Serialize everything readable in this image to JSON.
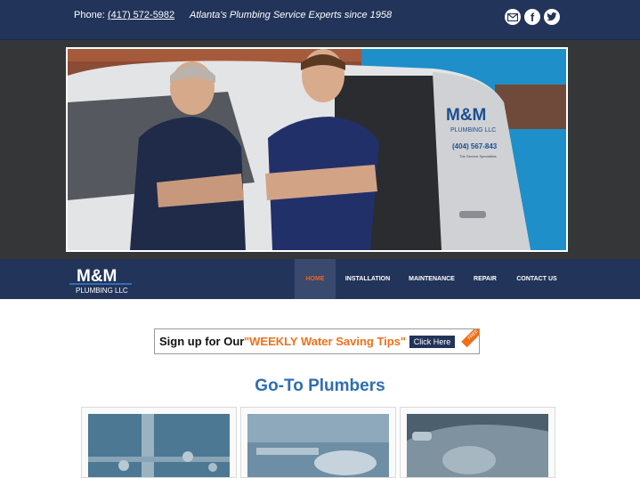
{
  "topbar": {
    "phone_label": "Phone:",
    "phone_number": "(417) 572-5982",
    "tagline": "Atlanta's Plumbing Service Experts since 1958",
    "social": [
      {
        "icon": "email-icon"
      },
      {
        "icon": "facebook-icon",
        "glyph": "f"
      },
      {
        "icon": "twitter-icon"
      }
    ]
  },
  "hero": {
    "van_logo_line1": "M&M",
    "van_logo_line2": "PLUMBING LLC",
    "van_phone": "(404) 567-843",
    "van_slogan": "The Service Specialists"
  },
  "logo": {
    "line1": "M&M",
    "line2": "PLUMBING LLC"
  },
  "nav": {
    "items": [
      {
        "label": "HOME",
        "active": true
      },
      {
        "label": "INSTALLATION",
        "active": false
      },
      {
        "label": "MAINTENANCE",
        "active": false
      },
      {
        "label": "REPAIR",
        "active": false
      },
      {
        "label": "CONTACT US",
        "active": false
      }
    ]
  },
  "banner": {
    "lead": "Sign up for Our",
    "highlight": "\"WEEKLY Water Saving Tips\"",
    "button": "Click Here",
    "ribbon": "FREE"
  },
  "section": {
    "title": "Go-To Plumbers"
  },
  "colors": {
    "navy": "#223459",
    "accent_orange": "#f0601f",
    "title_blue": "#2e6db3",
    "hero_bg": "#353638"
  }
}
